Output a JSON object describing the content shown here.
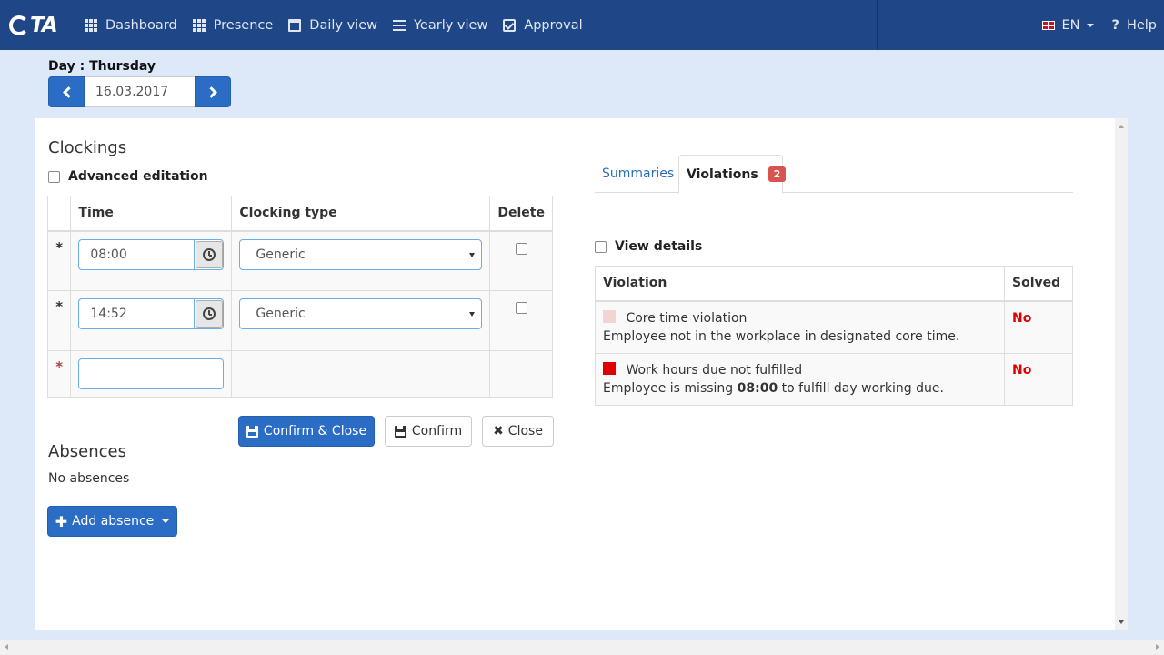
{
  "app": {
    "logo_text": "TA"
  },
  "nav": {
    "items": [
      {
        "label": "Dashboard",
        "icon": "grid-icon"
      },
      {
        "label": "Presence",
        "icon": "grid-icon"
      },
      {
        "label": "Daily view",
        "icon": "calendar-icon"
      },
      {
        "label": "Yearly view",
        "icon": "list-icon"
      },
      {
        "label": "Approval",
        "icon": "check-square-icon"
      }
    ],
    "language": "EN",
    "help": "Help"
  },
  "day": {
    "label": "Day : Thursday",
    "date": "16.03.2017"
  },
  "clockings": {
    "title": "Clockings",
    "advanced_label": "Advanced editation",
    "headers": {
      "time": "Time",
      "type": "Clocking type",
      "delete": "Delete"
    },
    "rows": [
      {
        "marker": "*",
        "time": "08:00",
        "type": "Generic"
      },
      {
        "marker": "*",
        "time": "14:52",
        "type": "Generic"
      },
      {
        "marker": "*",
        "time": ""
      }
    ],
    "buttons": {
      "confirm_close": "Confirm & Close",
      "confirm": "Confirm",
      "close": "Close"
    }
  },
  "absences": {
    "title": "Absences",
    "empty_text": "No absences",
    "add_button": "Add absence"
  },
  "tabs": {
    "summaries": "Summaries",
    "violations": "Violations",
    "violations_count": "2"
  },
  "violations": {
    "view_details_label": "View details",
    "headers": {
      "violation": "Violation",
      "solved": "Solved"
    },
    "rows": [
      {
        "color": "#f2d4d4",
        "title": "Core time violation",
        "desc": "Employee not in the workplace in designated core time.",
        "solved": "No"
      },
      {
        "color": "#e00000",
        "title": "Work hours due not fulfilled",
        "desc_pre": "Employee is missing ",
        "desc_bold": "08:00",
        "desc_post": " to fulfill day working due.",
        "solved": "No"
      }
    ]
  },
  "colors": {
    "navbar": "#1f4788",
    "primary": "#2b6cc4",
    "page_bg": "#dde9f8",
    "danger": "#d9534f"
  }
}
